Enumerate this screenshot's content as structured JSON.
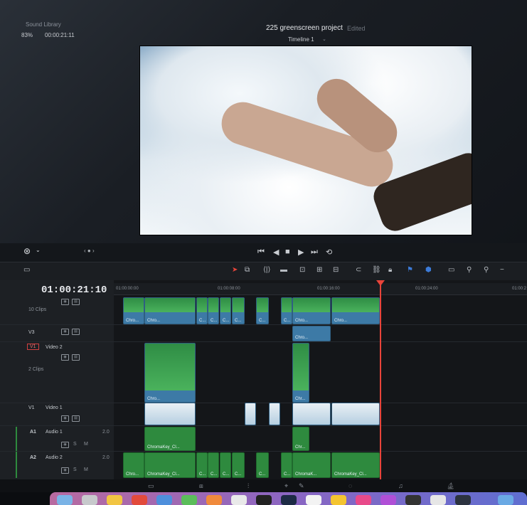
{
  "viewer": {
    "top_left_label": "Sound Library",
    "zoom": "83%",
    "timecode": "00:00:21:11",
    "project_title": "225 greenscreen project",
    "status": "Edited",
    "timeline_name": "Timeline 1"
  },
  "transport": {
    "icons": [
      "go-to-start-icon",
      "play-reverse-icon",
      "stop-icon",
      "play-icon",
      "go-to-end-icon",
      "loop-icon"
    ],
    "glyphs": [
      "⏮",
      "◀",
      "■",
      "▶",
      "⏭",
      "⟲"
    ]
  },
  "timeline": {
    "timecode": "01:00:21:10",
    "ruler": [
      "01:00:00:00",
      "01:00:08:00",
      "01:00:16:00",
      "01:00:24:00",
      "01:00:2"
    ],
    "tracks": {
      "v4_clips": "10 Clips",
      "v3_label": "V3",
      "v2_id": "V1",
      "v2_name": "Video 2",
      "v2_clips": "2 Clips",
      "v1_id": "V1",
      "v1_name": "Video 1",
      "a1_id": "A1",
      "a1_name": "Audio 1",
      "a1_level": "2.0",
      "a2_id": "A2",
      "a2_name": "Audio 2",
      "a2_level": "2.0",
      "solo": "S",
      "mute": "M"
    },
    "clip_labels": {
      "chro": "Chro...",
      "chro2": "Chro...",
      "c": "C...",
      "cr": "Chr...",
      "chromakey": "ChromaKey_Cl...",
      "chromak": "ChromaK..."
    }
  },
  "colors": {
    "playhead": "#e8443a",
    "video_clip": "#3d7aa6",
    "audio_clip": "#2e8a3e"
  }
}
